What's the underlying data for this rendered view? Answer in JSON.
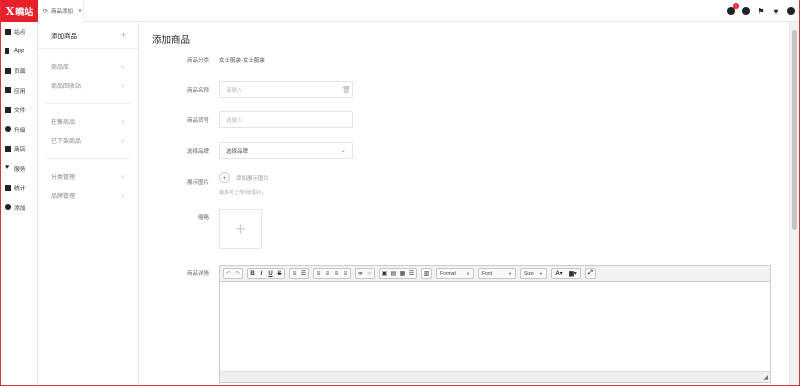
{
  "brand": {
    "logo_x": "X",
    "logo_text": "曉站",
    "accent": "#e8202a"
  },
  "tabs": [
    {
      "label": "商品添加",
      "close": "×"
    }
  ],
  "header": {
    "message_count": "1"
  },
  "nav1": [
    {
      "label": "站点",
      "icon": "sitemap-icon"
    },
    {
      "label": "App",
      "icon": "mobile-icon"
    },
    {
      "label": "页面",
      "icon": "page-icon"
    },
    {
      "label": "应用",
      "icon": "app-icon"
    },
    {
      "label": "文件",
      "icon": "folder-icon"
    },
    {
      "label": "升级",
      "icon": "cloud-upgrade-icon"
    },
    {
      "label": "商店",
      "icon": "store-icon"
    },
    {
      "label": "服务",
      "icon": "heart-icon"
    },
    {
      "label": "统计",
      "icon": "stats-icon"
    },
    {
      "label": "添加",
      "icon": "add-circle-icon"
    }
  ],
  "nav2": {
    "head": "添加商品",
    "groups": [
      [
        "商品库",
        "商品回收站"
      ],
      [
        "在售商品",
        "已下架商品"
      ],
      [
        "分类管理",
        "品牌管理"
      ]
    ]
  },
  "form": {
    "title": "添加商品",
    "category_label": "商品分类",
    "category_value": "女士服装-女士服装",
    "name_label": "商品名称",
    "name_placeholder": "请输入",
    "code_label": "商品货号",
    "code_placeholder": "请输入",
    "brand_label": "选择品牌",
    "brand_value": "选择品牌",
    "images_label": "展示图片",
    "add_images": "添加展示图片",
    "images_hint": "最多可上传9张图片。",
    "thumb_label": "缩略",
    "detail_label": "商品详情"
  },
  "editor": {
    "format": "Format",
    "font": "Font",
    "size": "Size"
  }
}
